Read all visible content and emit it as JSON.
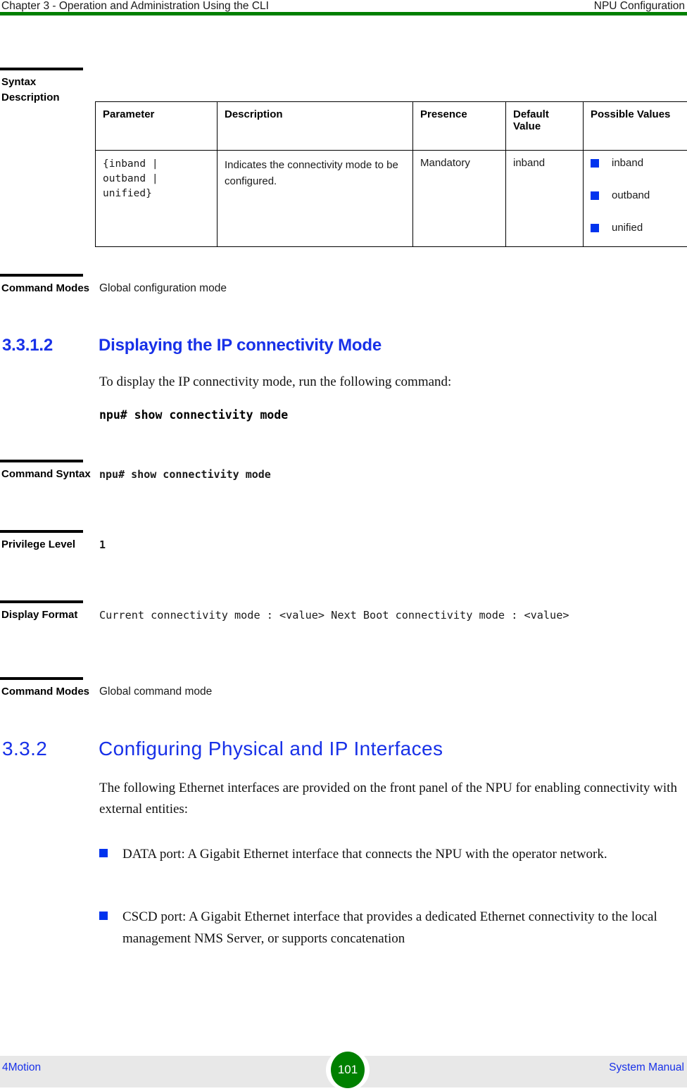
{
  "header": {
    "left": "Chapter 3 - Operation and Administration Using the CLI",
    "right": "NPU Configuration",
    "rule_color": "#008000"
  },
  "syntax_description": {
    "label": "Syntax Description",
    "table": {
      "columns": [
        "Parameter",
        "Description",
        "Presence",
        "Default Value",
        "Possible Values"
      ],
      "rows": [
        {
          "parameter": "{inband |\noutband |\nunified}",
          "description": "Indicates the connectivity mode to be configured.",
          "presence": "Mandatory",
          "default_value": "inband",
          "possible_values": [
            "inband",
            "outband",
            "unified"
          ]
        }
      ]
    },
    "bullet_color": "#0033EE"
  },
  "command_modes_1": {
    "label": "Command Modes",
    "value": "Global configuration mode"
  },
  "section_3312": {
    "number": "3.3.1.2",
    "title": "Displaying the IP connectivity Mode",
    "color": "#1831E8",
    "paragraph": "To display the IP connectivity mode, run the following command:",
    "command": "npu# show connectivity mode"
  },
  "command_syntax": {
    "label": "Command Syntax",
    "value": "npu# show connectivity mode"
  },
  "privilege_level": {
    "label": "Privilege Level",
    "value": "1"
  },
  "display_format": {
    "label": "Display Format",
    "value": "Current connectivity mode : <value> Next Boot connectivity mode : <value>"
  },
  "command_modes_2": {
    "label": "Command Modes",
    "value": "Global command mode"
  },
  "section_332": {
    "number": "3.3.2",
    "title": "Configuring Physical and IP Interfaces",
    "color": "#1831E8",
    "paragraph": "The following Ethernet interfaces are provided on the front panel of the NPU for enabling connectivity with external entities:",
    "bullets": [
      "DATA port: A Gigabit Ethernet interface that connects the NPU with the operator network.",
      "CSCD port: A Gigabit Ethernet interface that provides a dedicated Ethernet connectivity to the local management NMS Server, or supports concatenation"
    ]
  },
  "footer": {
    "left": "4Motion",
    "page_number": "101",
    "right": "System Manual",
    "badge_color": "#008000",
    "band_color": "#e8e8e8"
  }
}
